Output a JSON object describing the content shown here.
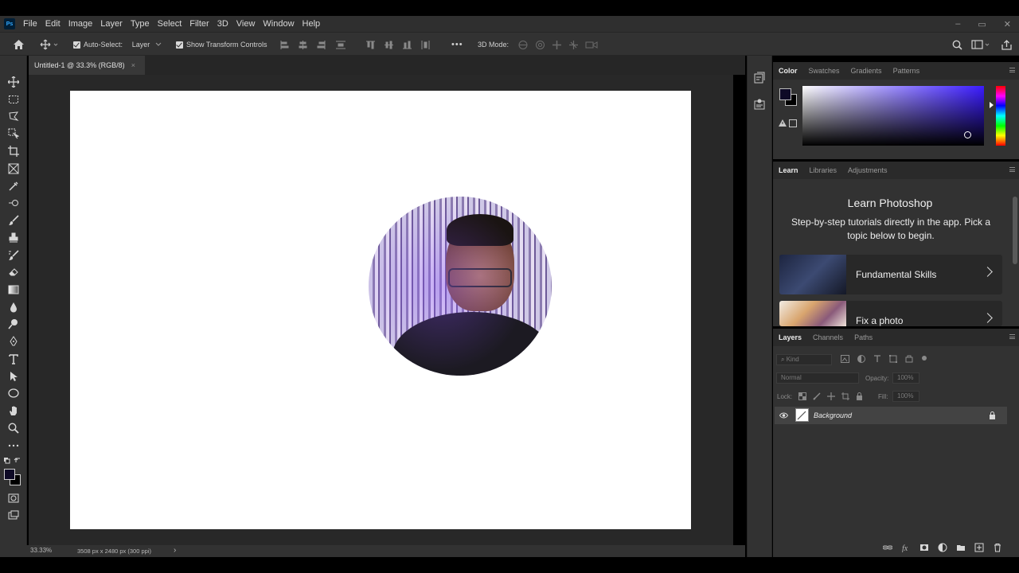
{
  "app": {
    "logo_text": "Ps",
    "menu": [
      "File",
      "Edit",
      "Image",
      "Layer",
      "Type",
      "Select",
      "Filter",
      "3D",
      "View",
      "Window",
      "Help"
    ],
    "window_controls": [
      "–",
      "▭",
      "✕"
    ]
  },
  "options_bar": {
    "auto_select_label": "Auto-Select:",
    "auto_select_target": "Layer",
    "show_transform_label": "Show Transform Controls",
    "mode_3d_label": "3D Mode:",
    "more_label": "•••"
  },
  "document": {
    "tab_title": "Untitled-1 @ 33.3% (RGB/8)",
    "tab_close": "×"
  },
  "status_bar": {
    "zoom": "33.33%",
    "doc_info": "3508 px x 2480 px (300 ppi)",
    "arrow": "›"
  },
  "color_panel": {
    "tabs": [
      "Color",
      "Swatches",
      "Gradients",
      "Patterns"
    ],
    "active_tab": "Color",
    "foreground_color": "#0e0a26",
    "background_color": "#000000"
  },
  "learn_panel": {
    "tabs": [
      "Learn",
      "Libraries",
      "Adjustments"
    ],
    "active_tab": "Learn",
    "heading": "Learn Photoshop",
    "description": "Step-by-step tutorials directly in the app. Pick a topic below to begin.",
    "cards": [
      {
        "label": "Fundamental Skills"
      },
      {
        "label": "Fix a photo"
      }
    ]
  },
  "layers_panel": {
    "tabs": [
      "Layers",
      "Channels",
      "Paths"
    ],
    "active_tab": "Layers",
    "filter_kind": "Kind",
    "blend_mode": "Normal",
    "opacity_label": "Opacity:",
    "opacity_value": "100%",
    "lock_label": "Lock:",
    "fill_label": "Fill:",
    "fill_value": "100%",
    "layers": [
      {
        "name": "Background",
        "visible": true,
        "locked": true
      }
    ]
  }
}
